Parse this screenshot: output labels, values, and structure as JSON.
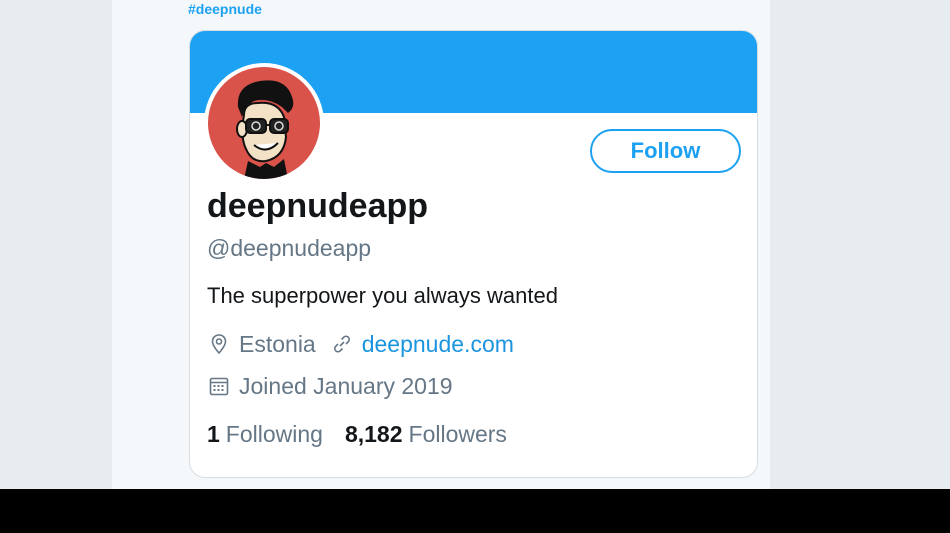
{
  "hashtag": "#deepnude",
  "profile": {
    "display_name": "deepnudeapp",
    "handle": "@deepnudeapp",
    "bio": "The superpower you always wanted",
    "location": "Estonia",
    "website": "deepnude.com",
    "joined": "Joined January 2019",
    "follow_label": "Follow",
    "following_count": "1",
    "following_label": "Following",
    "followers_count": "8,182",
    "followers_label": "Followers"
  },
  "icons": {
    "location": "location-pin-icon",
    "link": "link-icon",
    "calendar": "calendar-icon"
  },
  "colors": {
    "accent": "#1da1f2",
    "banner": "#1da1f2",
    "avatar_bg": "#d9534a",
    "text_primary": "#14171a",
    "text_secondary": "#657786"
  }
}
